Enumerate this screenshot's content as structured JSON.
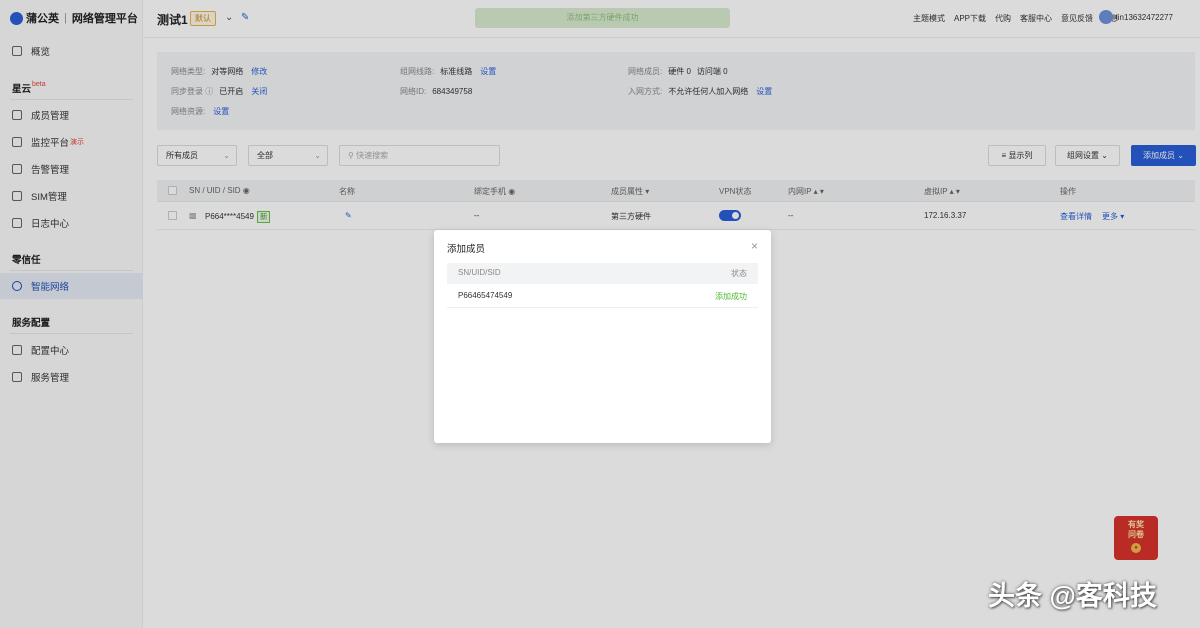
{
  "brand": {
    "name": "蒲公英",
    "product": "网络管理平台"
  },
  "sidebar": {
    "overview": "概览",
    "sections": [
      {
        "title": "星云",
        "badge": "beta",
        "items": [
          {
            "label": "成员管理",
            "icon": "members-icon"
          },
          {
            "label": "监控平台",
            "badge": "演示",
            "icon": "monitor-icon"
          },
          {
            "label": "告警管理",
            "icon": "bell-icon"
          },
          {
            "label": "SIM管理",
            "icon": "sim-icon"
          },
          {
            "label": "日志中心",
            "icon": "log-icon"
          }
        ]
      },
      {
        "title": "零信任",
        "items": [
          {
            "label": "智能网络",
            "icon": "network-icon",
            "active": true
          }
        ]
      },
      {
        "title": "服务配置",
        "items": [
          {
            "label": "配置中心",
            "icon": "grid-icon"
          },
          {
            "label": "服务管理",
            "icon": "service-icon"
          }
        ]
      }
    ]
  },
  "header": {
    "title": "测试1",
    "default_tag": "默认",
    "toast": "添加第三方硬件成功",
    "links": [
      "主题模式",
      "APP下载",
      "代购",
      "客服中心",
      "意见反馈",
      "消息"
    ],
    "username": "lin13632472277"
  },
  "info": {
    "network_type": {
      "key": "网络类型:",
      "value": "对等网络",
      "action": "修改"
    },
    "line": {
      "key": "组网线路:",
      "value": "标准线路",
      "action": "设置"
    },
    "members": {
      "key": "网络成员:",
      "value": "硬件 0",
      "value2": "访问端 0"
    },
    "sync_login": {
      "key": "同步登录",
      "value": "已开启",
      "action": "关闭"
    },
    "network_id": {
      "key": "网络ID:",
      "value": "684349758"
    },
    "join_mode": {
      "key": "入网方式:",
      "value": "不允许任何人加入网络",
      "action": "设置"
    },
    "resources": {
      "key": "网络资源:",
      "action": "设置"
    }
  },
  "toolbar": {
    "member_filter": "所有成员",
    "scope_filter": "全部",
    "search_placeholder": "快速搜索",
    "display_columns": "显示列",
    "network_settings": "组网设置",
    "add_member": "添加成员"
  },
  "table": {
    "headers": [
      "SN / UID / SID",
      "名称",
      "绑定手机",
      "成员属性",
      "VPN状态",
      "内网IP",
      "虚拟IP",
      "操作"
    ],
    "rows": [
      {
        "id": "P664****4549",
        "tag": "新",
        "phone": "--",
        "attribute": "第三方硬件",
        "vpn_on": true,
        "lan_ip": "--",
        "virtual_ip": "172.16.3.37",
        "action1": "查看详情",
        "action2": "更多"
      }
    ]
  },
  "modal": {
    "title": "添加成员",
    "headers": [
      "SN/UID/SID",
      "状态"
    ],
    "rows": [
      {
        "id": "P66465474549",
        "status": "添加成功"
      }
    ]
  },
  "gift": {
    "line1": "有奖",
    "line2": "问卷"
  },
  "watermark": "头条 @客科技",
  "colors": {
    "primary": "#2a5fd8",
    "success": "#52b82c",
    "active_bg": "#e6ebf5"
  }
}
